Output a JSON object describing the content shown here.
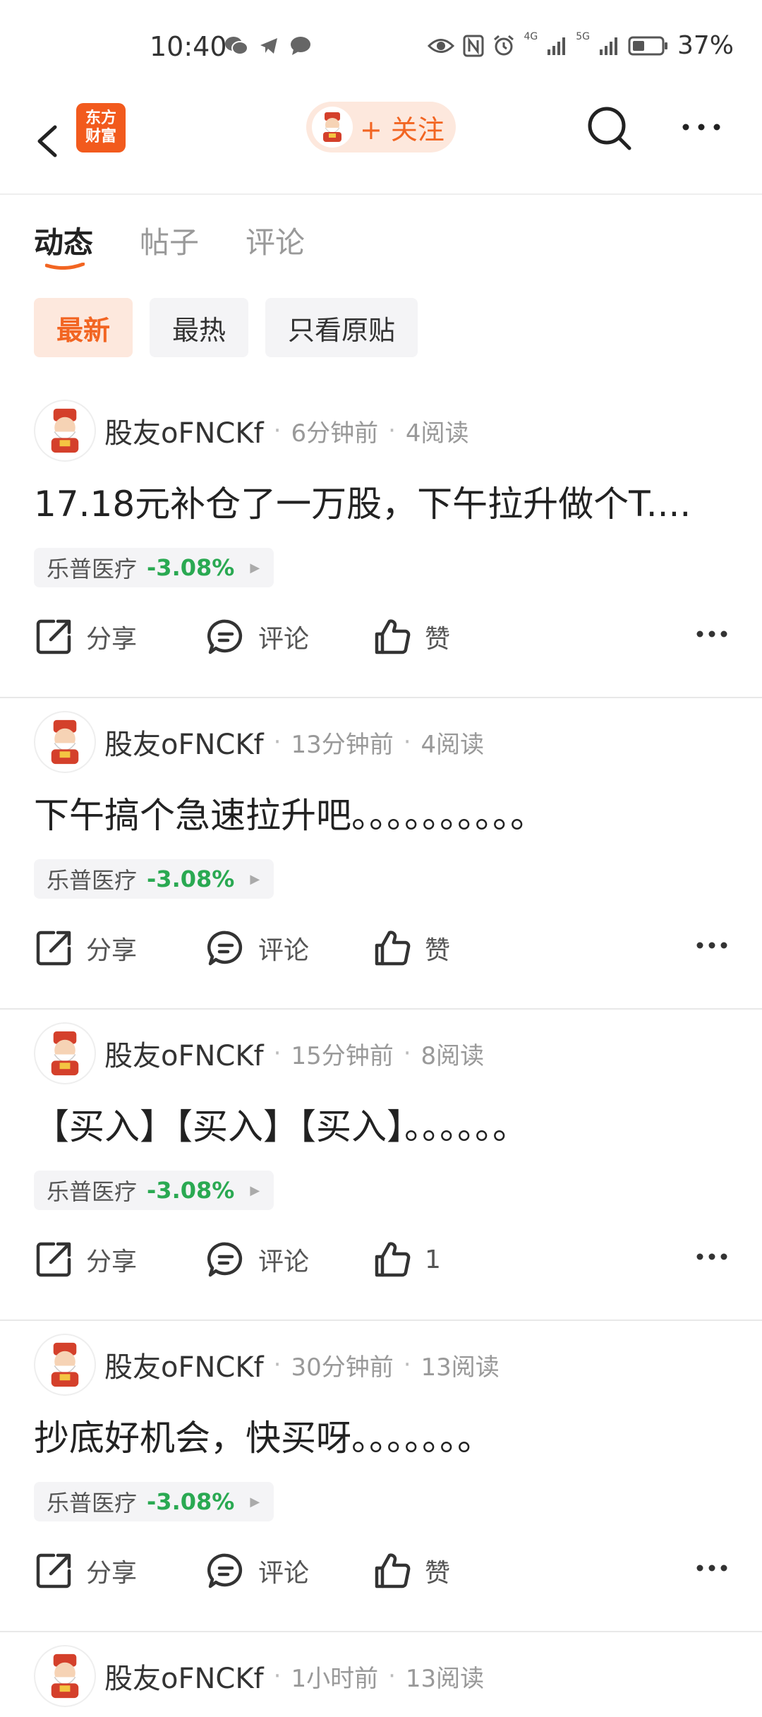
{
  "status_bar": {
    "time": "10:40",
    "network_left": "4G",
    "network_right": "5G",
    "battery_pct": "37%"
  },
  "header": {
    "brand_line1": "东方",
    "brand_line2": "财富",
    "follow_label": "+ 关注"
  },
  "tabs": [
    {
      "label": "动态",
      "active": true
    },
    {
      "label": "帖子",
      "active": false
    },
    {
      "label": "评论",
      "active": false
    }
  ],
  "filters": [
    {
      "label": "最新",
      "active": true
    },
    {
      "label": "最热",
      "active": false
    },
    {
      "label": "只看原贴",
      "active": false
    }
  ],
  "colors": {
    "accent": "#f26522",
    "accent_bg": "#fde8dd",
    "down_green": "#2aa952",
    "brand": "#f25a1d"
  },
  "posts": [
    {
      "author": "股友oFNCKf",
      "time": "6分钟前",
      "reads": "4阅读",
      "text": "17.18元补仓了一万股，下午拉升做个T....",
      "stock_name": "乐普医疗",
      "stock_change": "-3.08%",
      "share": "分享",
      "comment": "评论",
      "like": "赞"
    },
    {
      "author": "股友oFNCKf",
      "time": "13分钟前",
      "reads": "4阅读",
      "text": "下午搞个急速拉升吧。。。。。。。。。。",
      "stock_name": "乐普医疗",
      "stock_change": "-3.08%",
      "share": "分享",
      "comment": "评论",
      "like": "赞"
    },
    {
      "author": "股友oFNCKf",
      "time": "15分钟前",
      "reads": "8阅读",
      "text": "【买入】【买入】【买入】。。。。。。",
      "stock_name": "乐普医疗",
      "stock_change": "-3.08%",
      "share": "分享",
      "comment": "评论",
      "like": "1"
    },
    {
      "author": "股友oFNCKf",
      "time": "30分钟前",
      "reads": "13阅读",
      "text": "抄底好机会，快买呀。。。。。。。",
      "stock_name": "乐普医疗",
      "stock_change": "-3.08%",
      "share": "分享",
      "comment": "评论",
      "like": "赞"
    },
    {
      "author": "股友oFNCKf",
      "time": "1小时前",
      "reads": "13阅读"
    }
  ]
}
